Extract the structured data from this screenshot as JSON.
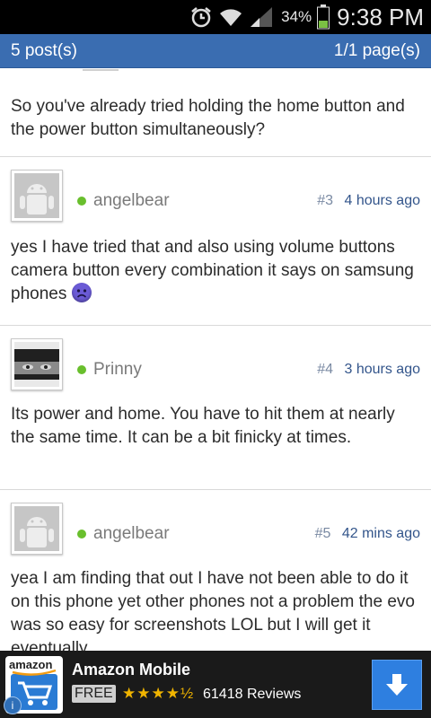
{
  "status_bar": {
    "battery_percent": "34%",
    "time": "9:38 PM",
    "icons": [
      "alarm-icon",
      "wifi-icon",
      "signal-icon",
      "battery-icon"
    ]
  },
  "title_bar": {
    "posts_count": "5 post(s)",
    "page_indicator": "1/1 page(s)",
    "background_color": "#3a6db1"
  },
  "posts": [
    {
      "text": "So you've already tried holding the home button and the power button simultaneously?"
    },
    {
      "username": "angelbear",
      "number": "#3",
      "time": "4 hours ago",
      "avatar": "android-avatar-icon",
      "text": "yes I have tried that and also using volume buttons camera button every combination it says on samsung phones",
      "emoticon": "sad-face-icon"
    },
    {
      "username": "Prinny",
      "number": "#4",
      "time": "3 hours ago",
      "avatar": "user-photo-avatar",
      "text": "Its power and home. You have to hit them at nearly the same time. It can be a bit finicky at times."
    },
    {
      "username": "angelbear",
      "number": "#5",
      "time": "42 mins ago",
      "avatar": "android-avatar-icon",
      "text": "yea I am finding that out I have not been able to do it on this phone yet other phones not a problem the evo was so easy for screenshots LOL but I will get it eventually"
    }
  ],
  "ad": {
    "logo_text": "amazon",
    "title": "Amazon Mobile",
    "badge": "FREE",
    "stars": "★★★★½",
    "rating": 4.5,
    "reviews": "61418 Reviews",
    "info_glyph": "i"
  }
}
